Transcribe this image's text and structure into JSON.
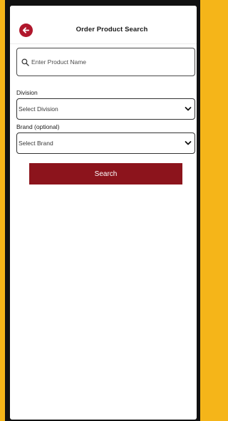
{
  "header": {
    "title": "Order Product Search"
  },
  "search": {
    "placeholder": "Enter Product Name"
  },
  "division": {
    "label": "Division",
    "selected": "Select Division"
  },
  "brand": {
    "label": "Brand (optional)",
    "selected": "Select Brand"
  },
  "actions": {
    "search_label": "Search"
  },
  "colors": {
    "background": "#f5b519",
    "accent": "#b0172c",
    "button": "#8c141c"
  }
}
